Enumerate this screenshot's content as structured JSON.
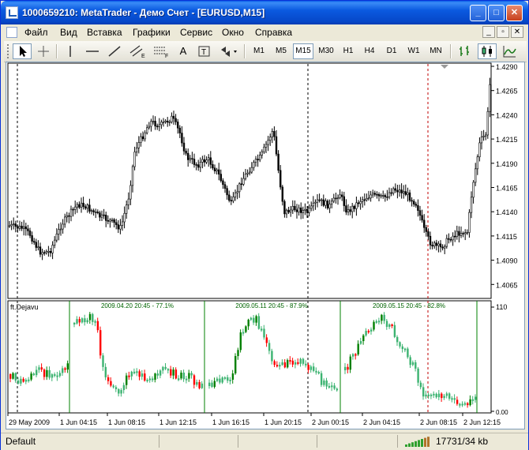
{
  "window": {
    "title": "1000659210: MetaTrader - Демо Счет - [EURUSD,M15]"
  },
  "menu": [
    "Файл",
    "Вид",
    "Вставка",
    "Графики",
    "Сервис",
    "Окно",
    "Справка"
  ],
  "toolbar": {
    "timeframes": [
      "M1",
      "M5",
      "M15",
      "M30",
      "H1",
      "H4",
      "D1",
      "W1",
      "MN"
    ],
    "active_timeframe": "M15",
    "text_tool": "A"
  },
  "chart": {
    "symbol": "EURUSD",
    "period": "M15",
    "price_levels": [
      "1.4290",
      "1.4265",
      "1.4240",
      "1.4215",
      "1.4190",
      "1.4165",
      "1.4140",
      "1.4115",
      "1.4090",
      "1.4065"
    ],
    "time_labels": [
      "29 May 2009",
      "1 Jun 04:15",
      "1 Jun 08:15",
      "1 Jun 12:15",
      "1 Jun 16:15",
      "1 Jun 20:15",
      "2 Jun 00:15",
      "2 Jun 04:15",
      "2 Jun 08:15",
      "2 Jun 12:15"
    ],
    "colors": {
      "candle": "#000000",
      "bull": "#3cb371",
      "strong_bull": "#008000",
      "bear": "#ff0000",
      "separator": "#008000",
      "current_line": "#c00000"
    }
  },
  "indicator": {
    "name": "ft.Dejavu",
    "scale_top": "110",
    "scale_bottom": "0.00",
    "matches": [
      "2009.04.20 20:45 - 77.1%",
      "2009.05.11 20:45 - 87.9%",
      "2009.05.15 20:45 - 82.8%"
    ]
  },
  "status": {
    "profile": "Default",
    "traffic": "17731/34 kb"
  }
}
